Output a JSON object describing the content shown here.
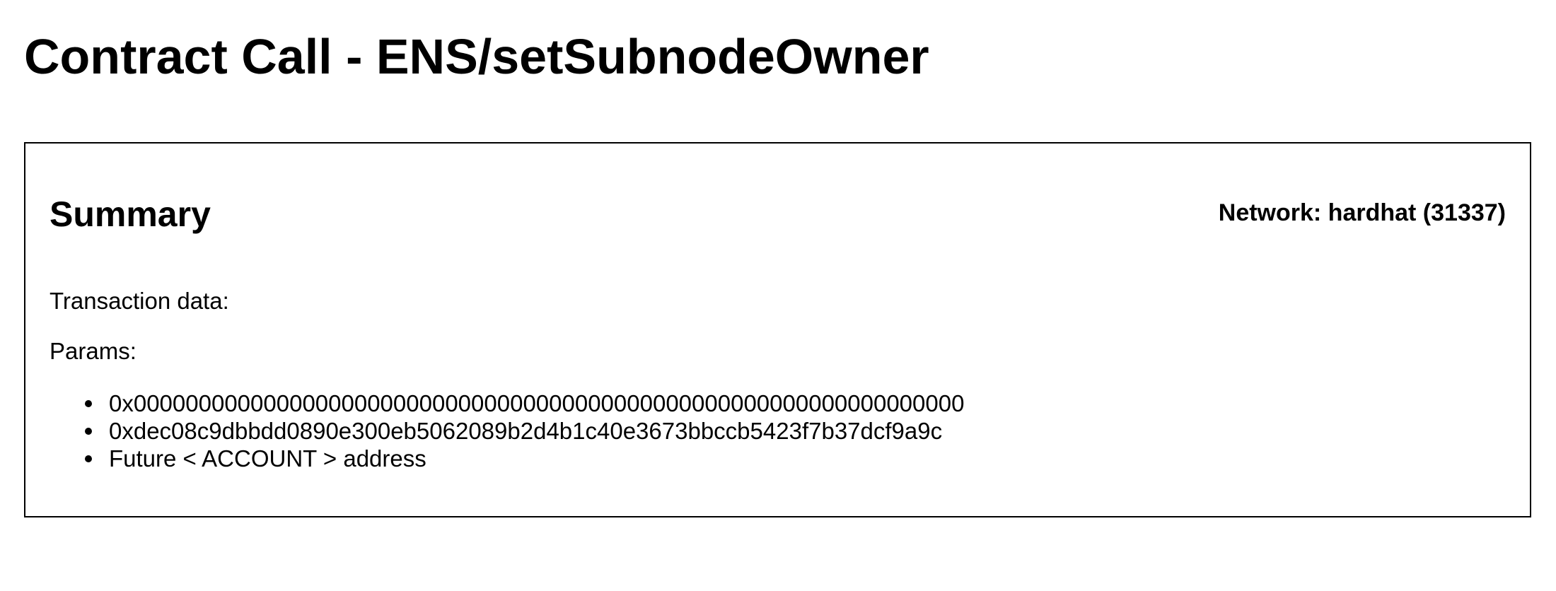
{
  "page": {
    "title": "Contract Call - ENS/setSubnodeOwner"
  },
  "summary": {
    "title": "Summary",
    "network": "Network: hardhat (31337)",
    "transaction_data_label": "Transaction data:",
    "params_label": "Params:",
    "params": [
      "0x0000000000000000000000000000000000000000000000000000000000000000",
      "0xdec08c9dbbdd0890e300eb5062089b2d4b1c40e3673bbccb5423f7b37dcf9a9c",
      "Future < ACCOUNT > address"
    ]
  }
}
